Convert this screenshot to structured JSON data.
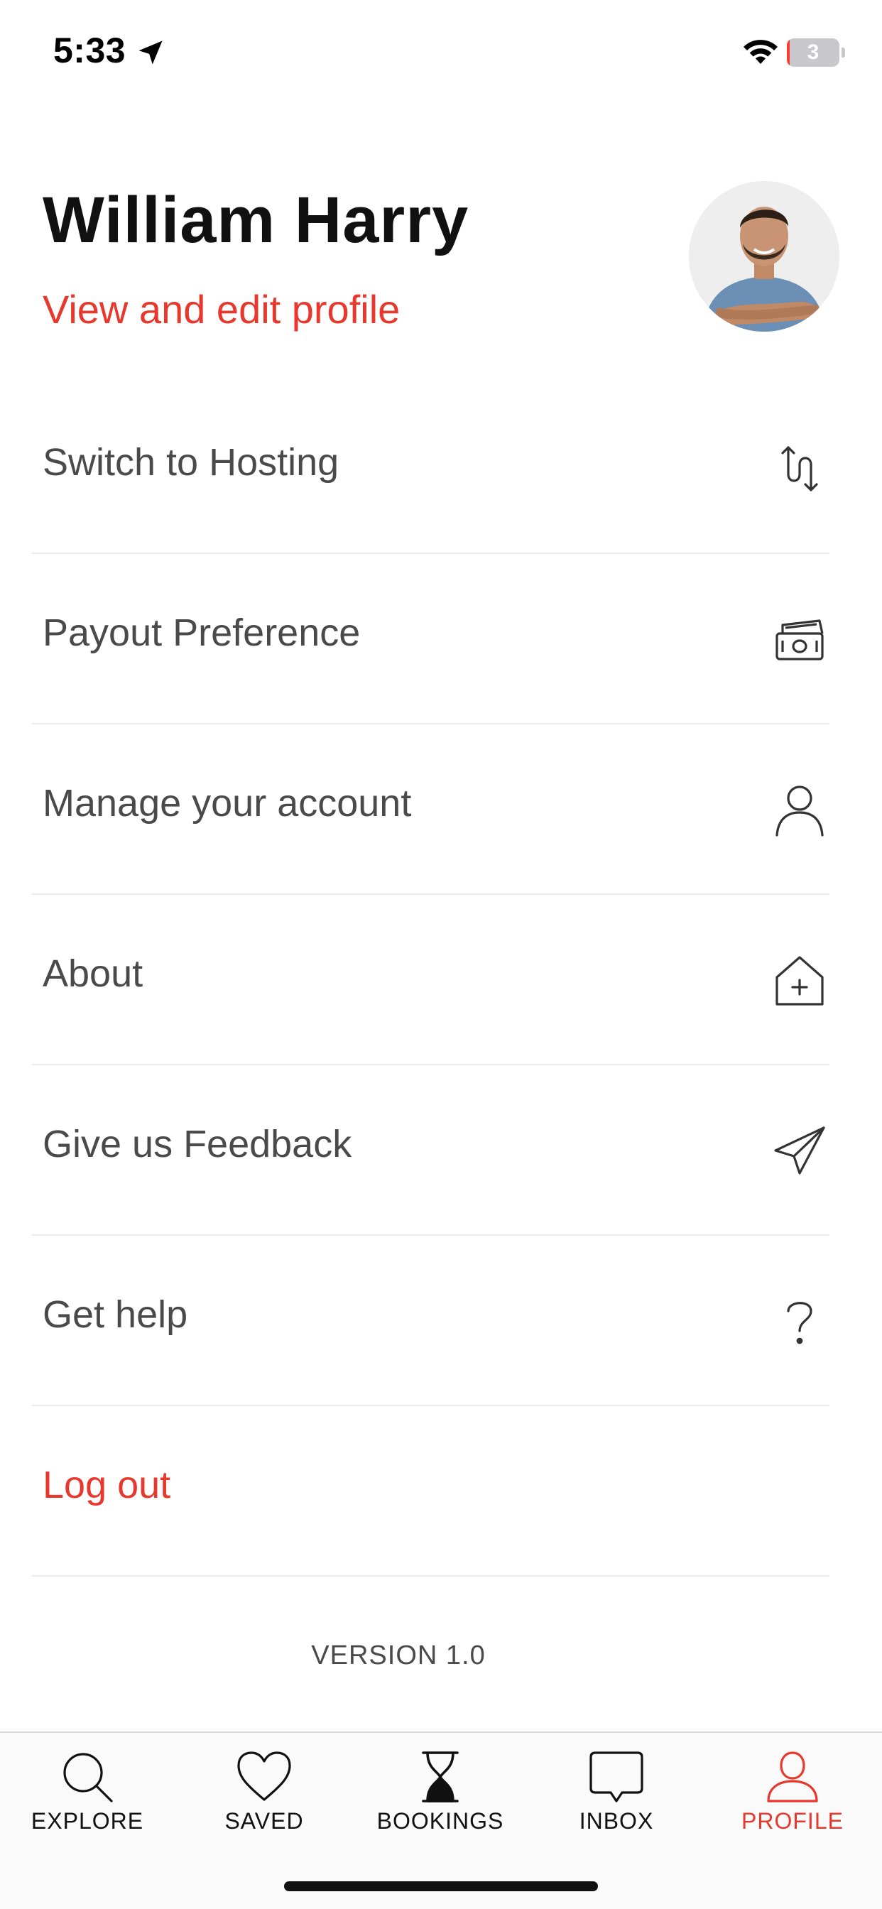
{
  "status_bar": {
    "time": "5:33",
    "battery_level": "3",
    "icons": [
      "location-arrow-icon",
      "wifi-icon",
      "battery-icon"
    ]
  },
  "profile": {
    "name": "William Harry",
    "edit_link": "View and edit profile",
    "avatar_icon": "user-avatar-photo"
  },
  "menu": {
    "items": [
      {
        "label": "Switch to Hosting",
        "icon": "switch-arrows-icon"
      },
      {
        "label": "Payout Preference",
        "icon": "cash-icon"
      },
      {
        "label": "Manage your account",
        "icon": "person-icon"
      },
      {
        "label": "About",
        "icon": "house-plus-icon"
      },
      {
        "label": "Give us Feedback",
        "icon": "paper-plane-icon"
      },
      {
        "label": "Get help",
        "icon": "question-mark-icon"
      },
      {
        "label": "Log out",
        "icon": ""
      }
    ]
  },
  "version_text": "VERSION 1.0",
  "tab_bar": {
    "tabs": [
      {
        "label": "EXPLORE",
        "icon": "search-icon"
      },
      {
        "label": "SAVED",
        "icon": "heart-icon"
      },
      {
        "label": "BOOKINGS",
        "icon": "hourglass-icon"
      },
      {
        "label": "INBOX",
        "icon": "chat-bubble-icon"
      },
      {
        "label": "PROFILE",
        "icon": "person-icon"
      }
    ],
    "active": "PROFILE"
  },
  "colors": {
    "accent": "#e8372c",
    "text_primary": "#111111",
    "text_secondary": "#4a4a4a",
    "divider": "#ebebeb"
  }
}
